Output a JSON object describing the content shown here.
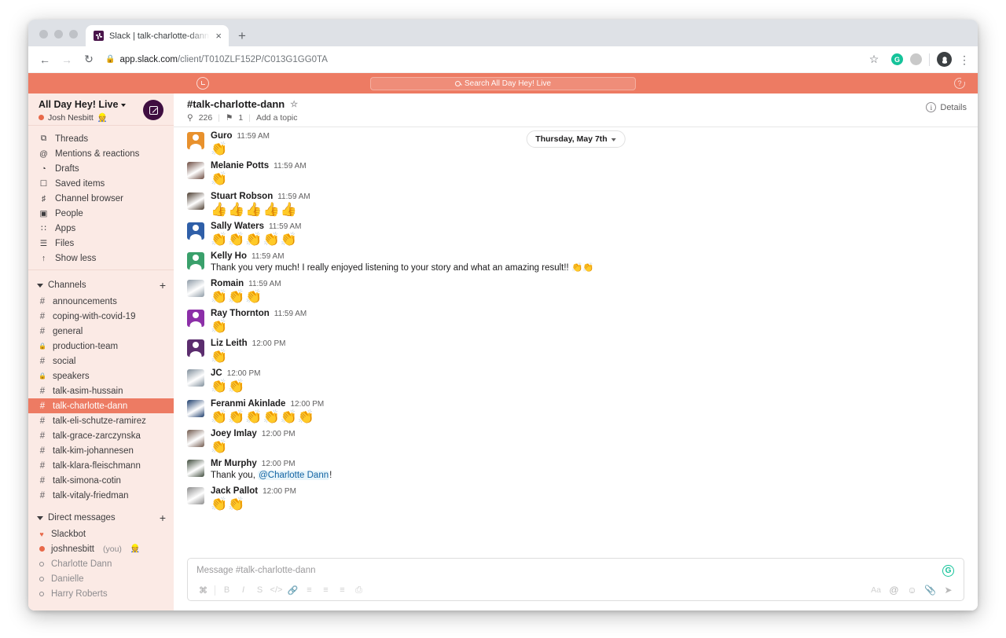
{
  "browser": {
    "tab_title": "Slack | talk-charlotte-dann | Al",
    "tab_close": "×",
    "new_tab": "+",
    "back": "←",
    "forward": "→",
    "reload": "↻",
    "lock": "🔒",
    "url_domain": "app.slack.com",
    "url_path": "/client/T010ZLF152P/C013G1GG0TA",
    "bookmark_star": "☆",
    "grammarly_badge": "G",
    "menu": "⋮"
  },
  "slack_top": {
    "history_icon": "clock-icon",
    "search_placeholder": "Search All Day Hey! Live",
    "help_icon": "?"
  },
  "sidebar": {
    "workspace": "All Day Hey! Live",
    "user": "Josh Nesbitt",
    "user_emoji": "👷",
    "compose_label": "compose-button",
    "nav": [
      {
        "icon": "⧉",
        "label": "Threads",
        "name": "threads"
      },
      {
        "icon": "@",
        "label": "Mentions & reactions",
        "name": "mentions"
      },
      {
        "icon": "◔",
        "label": "Drafts",
        "name": "drafts"
      },
      {
        "icon": "☐",
        "label": "Saved items",
        "name": "saved-items"
      },
      {
        "icon": "♯",
        "label": "Channel browser",
        "name": "channel-browser"
      },
      {
        "icon": "▣",
        "label": "People",
        "name": "people"
      },
      {
        "icon": "∷",
        "label": "Apps",
        "name": "apps"
      },
      {
        "icon": "☰",
        "label": "Files",
        "name": "files"
      },
      {
        "icon": "↑",
        "label": "Show less",
        "name": "show-less"
      }
    ],
    "channels_header": "Channels",
    "channels_add": "+",
    "channels": [
      {
        "prefix": "#",
        "name": "announcements",
        "active": false
      },
      {
        "prefix": "#",
        "name": "coping-with-covid-19",
        "active": false
      },
      {
        "prefix": "#",
        "name": "general",
        "active": false
      },
      {
        "prefix": "🔒",
        "name": "production-team",
        "active": false
      },
      {
        "prefix": "#",
        "name": "social",
        "active": false
      },
      {
        "prefix": "🔒",
        "name": "speakers",
        "active": false
      },
      {
        "prefix": "#",
        "name": "talk-asim-hussain",
        "active": false
      },
      {
        "prefix": "#",
        "name": "talk-charlotte-dann",
        "active": true
      },
      {
        "prefix": "#",
        "name": "talk-eli-schutze-ramirez",
        "active": false
      },
      {
        "prefix": "#",
        "name": "talk-grace-zarczynska",
        "active": false
      },
      {
        "prefix": "#",
        "name": "talk-kim-johannesen",
        "active": false
      },
      {
        "prefix": "#",
        "name": "talk-klara-fleischmann",
        "active": false
      },
      {
        "prefix": "#",
        "name": "talk-simona-cotin",
        "active": false
      },
      {
        "prefix": "#",
        "name": "talk-vitaly-friedman",
        "active": false
      }
    ],
    "dms_header": "Direct messages",
    "dms_add": "+",
    "dms": [
      {
        "name": "Slackbot",
        "status": "heart",
        "muted": false,
        "you": ""
      },
      {
        "name": "joshnesbitt",
        "status": "active",
        "muted": false,
        "you": "(you)",
        "emoji": "👷"
      },
      {
        "name": "Charlotte Dann",
        "status": "away",
        "muted": true,
        "you": ""
      },
      {
        "name": "Danielle",
        "status": "away",
        "muted": true,
        "you": ""
      },
      {
        "name": "Harry Roberts",
        "status": "away",
        "muted": true,
        "you": ""
      }
    ]
  },
  "channel": {
    "title": "#talk-charlotte-dann",
    "star": "☆",
    "members_icon": "⚲",
    "members_count": "226",
    "pin_icon": "⚑",
    "pin_count": "1",
    "topic": "Add a topic",
    "details_label": "Details",
    "details_icon": "i"
  },
  "date_divider": "Thursday, May 7th",
  "messages": [
    {
      "author": "Guro",
      "time": "11:59 AM",
      "emoji": "👏",
      "emoji_count": 1,
      "text": "",
      "avatar_color": "#e8912d",
      "avatar_type": "person"
    },
    {
      "author": "Melanie Potts",
      "time": "11:59 AM",
      "emoji": "👏",
      "emoji_count": 1,
      "text": "",
      "avatar_color": "#6b4a3f",
      "avatar_type": "photo"
    },
    {
      "author": "Stuart Robson",
      "time": "11:59 AM",
      "emoji": "👍",
      "emoji_count": 5,
      "text": "",
      "avatar_color": "#4a3b2e",
      "avatar_type": "photo"
    },
    {
      "author": "Sally Waters",
      "time": "11:59 AM",
      "emoji": "👏",
      "emoji_count": 5,
      "text": "",
      "avatar_color": "#2f5fa8",
      "avatar_type": "person"
    },
    {
      "author": "Kelly Ho",
      "time": "11:59 AM",
      "emoji": "",
      "emoji_count": 0,
      "text": "Thank you very much! I really enjoyed listening to your story and what an amazing result!! 👏👏",
      "avatar_color": "#3aa06b",
      "avatar_type": "person"
    },
    {
      "author": "Romain",
      "time": "11:59 AM",
      "emoji": "👏",
      "emoji_count": 3,
      "text": "",
      "avatar_color": "#8d9aa6",
      "avatar_type": "photo"
    },
    {
      "author": "Ray Thornton",
      "time": "11:59 AM",
      "emoji": "👏",
      "emoji_count": 1,
      "text": "",
      "avatar_color": "#8c2fa8",
      "avatar_type": "person"
    },
    {
      "author": "Liz Leith",
      "time": "12:00 PM",
      "emoji": "👏",
      "emoji_count": 1,
      "text": "",
      "avatar_color": "#5b2d6e",
      "avatar_type": "person"
    },
    {
      "author": "JC",
      "time": "12:00 PM",
      "emoji": "👏",
      "emoji_count": 2,
      "text": "",
      "avatar_color": "#7d8c99",
      "avatar_type": "photo"
    },
    {
      "author": "Feranmi Akinlade",
      "time": "12:00 PM",
      "emoji": "👏",
      "emoji_count": 6,
      "text": "",
      "avatar_color": "#1b3b6b",
      "avatar_type": "photo"
    },
    {
      "author": "Joey Imlay",
      "time": "12:00 PM",
      "emoji": "👏",
      "emoji_count": 1,
      "text": "",
      "avatar_color": "#6e564a",
      "avatar_type": "photo"
    },
    {
      "author": "Mr Murphy",
      "time": "12:00 PM",
      "emoji": "",
      "emoji_count": 0,
      "text": "Thank you, ",
      "mention": "@Charlotte Dann",
      "text_after": "!",
      "avatar_color": "#3d4a3a",
      "avatar_type": "photo"
    },
    {
      "author": "Jack Pallot",
      "time": "12:00 PM",
      "emoji": "👏",
      "emoji_count": 2,
      "text": "",
      "avatar_color": "#8a8a8a",
      "avatar_type": "photo"
    }
  ],
  "composer": {
    "placeholder": "Message #talk-charlotte-dann",
    "grammarly": "G",
    "format_buttons": [
      {
        "icon": "ℰ",
        "name": "formatting-toggle",
        "lead": true
      },
      {
        "icon": "B",
        "name": "bold"
      },
      {
        "icon": "I",
        "name": "italic"
      },
      {
        "icon": "S",
        "name": "strikethrough"
      },
      {
        "icon": "‹›",
        "name": "code"
      },
      {
        "icon": "🔗",
        "name": "link"
      },
      {
        "icon": "≡",
        "name": "ordered-list"
      },
      {
        "icon": "≡",
        "name": "bulleted-list"
      },
      {
        "icon": "≡",
        "name": "blockquote"
      },
      {
        "icon": "❑",
        "name": "code-block"
      }
    ],
    "right_buttons": [
      {
        "icon": "Aa",
        "name": "formatting"
      },
      {
        "icon": "@",
        "name": "mention"
      },
      {
        "icon": "☺",
        "name": "emoji"
      },
      {
        "icon": "📎",
        "name": "attachment"
      },
      {
        "icon": "➤",
        "name": "send"
      }
    ]
  }
}
